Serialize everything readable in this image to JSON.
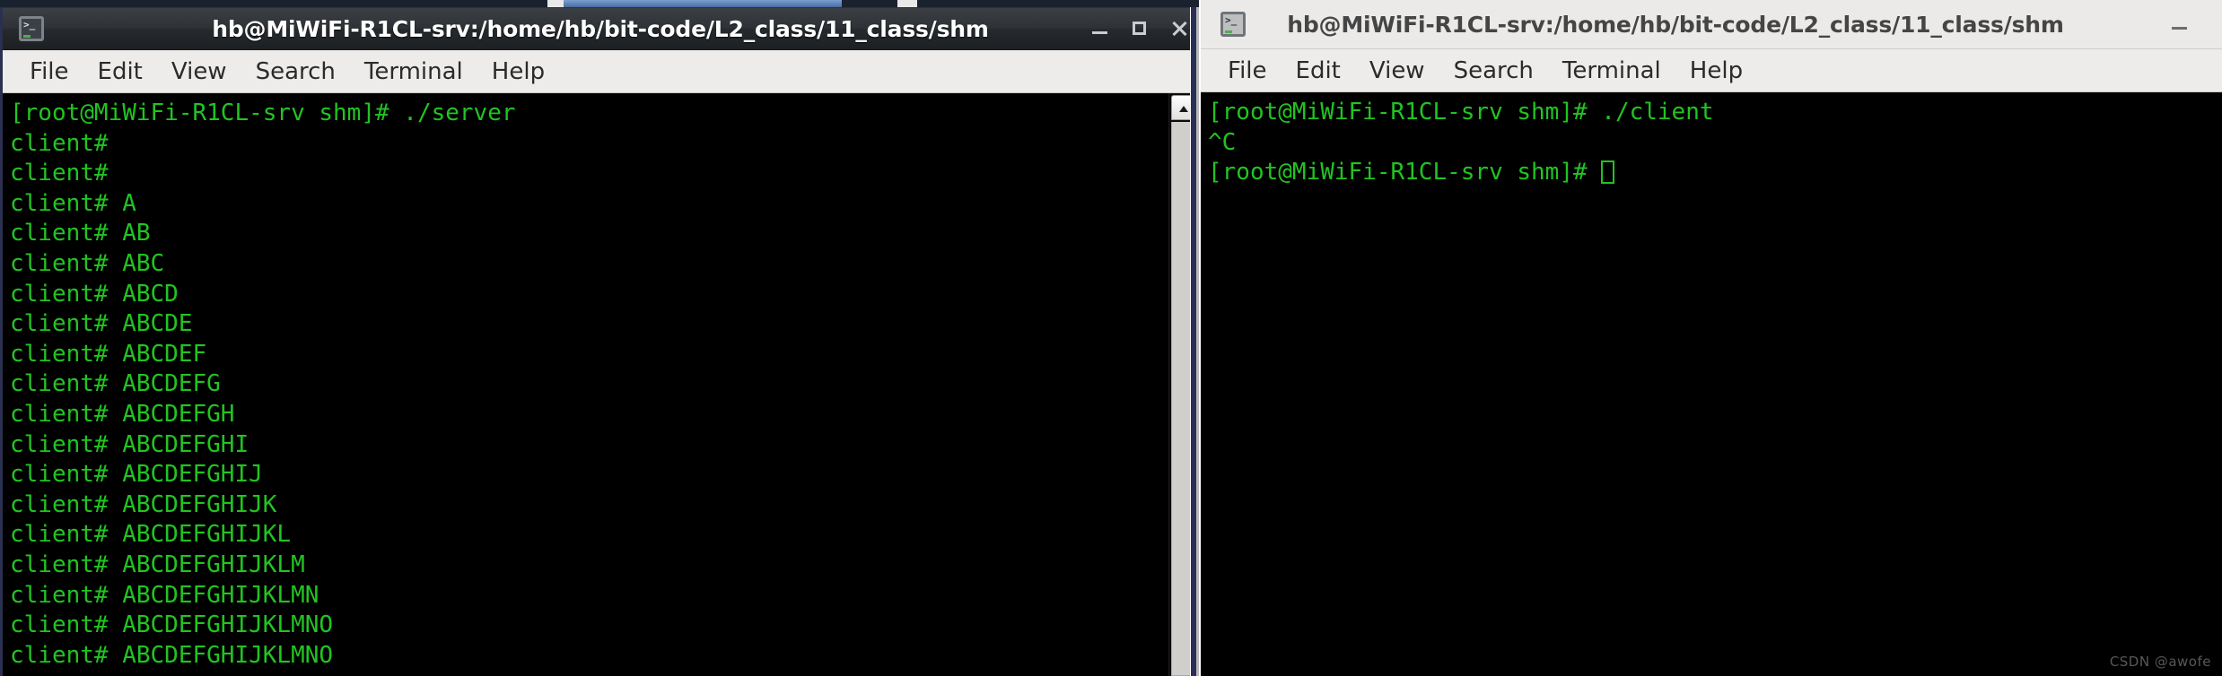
{
  "desktop": {
    "taskbar_chips": [
      "chip-1",
      "chip-2",
      "chip-3"
    ]
  },
  "windows": [
    {
      "id": "server-terminal",
      "state": "active",
      "title": "hb@MiWiFi-R1CL-srv:/home/hb/bit-code/L2_class/11_class/shm",
      "app_icon": "terminal-icon",
      "controls": {
        "minimize": "minimize-icon",
        "maximize": "maximize-icon",
        "close": "close-icon"
      },
      "menu": [
        "File",
        "Edit",
        "View",
        "Search",
        "Terminal",
        "Help"
      ],
      "terminal": {
        "prompt_user": "root@MiWiFi-R1CL-srv",
        "prompt_dir": "shm",
        "lines": [
          "[root@MiWiFi-R1CL-srv shm]# ./server",
          "client#",
          "client#",
          "client# A",
          "client# AB",
          "client# ABC",
          "client# ABCD",
          "client# ABCDE",
          "client# ABCDEF",
          "client# ABCDEFG",
          "client# ABCDEFGH",
          "client# ABCDEFGHI",
          "client# ABCDEFGHIJ",
          "client# ABCDEFGHIJK",
          "client# ABCDEFGHIJKL",
          "client# ABCDEFGHIJKLM",
          "client# ABCDEFGHIJKLMN",
          "client# ABCDEFGHIJKLMNO",
          "client# ABCDEFGHIJKLMNO"
        ],
        "text_color": "#22c322",
        "background_color": "#000000"
      },
      "scrollbar": {
        "up_arrow": "scroll-up-icon",
        "thumb_position": "bottom"
      }
    },
    {
      "id": "client-terminal",
      "state": "inactive",
      "title": "hb@MiWiFi-R1CL-srv:/home/hb/bit-code/L2_class/11_class/shm",
      "app_icon": "terminal-icon",
      "controls": {
        "minimize": "minimize-icon"
      },
      "menu": [
        "File",
        "Edit",
        "View",
        "Search",
        "Terminal",
        "Help"
      ],
      "terminal": {
        "prompt_user": "root@MiWiFi-R1CL-srv",
        "prompt_dir": "shm",
        "lines": [
          "[root@MiWiFi-R1CL-srv shm]# ./client",
          "^C",
          "[root@MiWiFi-R1CL-srv shm]# "
        ],
        "cursor": "block",
        "text_color": "#22c322",
        "background_color": "#000000"
      }
    }
  ],
  "watermark": "CSDN @awofe"
}
